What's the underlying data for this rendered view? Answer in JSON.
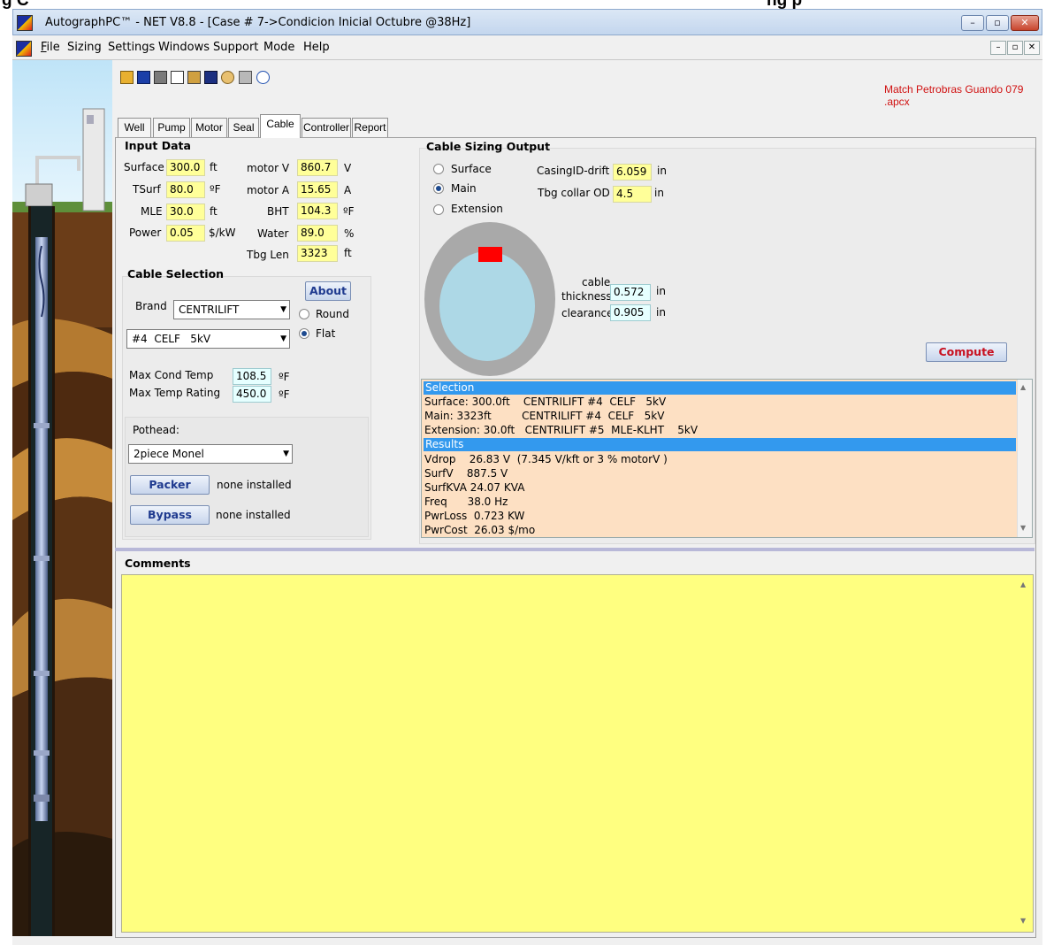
{
  "caption": "g C",
  "caption2": "ng p",
  "window": {
    "title": "AutographPC™ - NET V8.8 - [Case # 7->Condicion Inicial Octubre @38Hz]"
  },
  "menu": [
    "File",
    "Sizing",
    "Settings",
    "Windows",
    "Support",
    "Mode",
    "Help"
  ],
  "match_file": "Match Petrobras Guando 079 .apcx",
  "tabs": [
    "Well",
    "Pump",
    "Motor",
    "Seal",
    "Cable",
    "Controller",
    "Report"
  ],
  "active_tab": "Cable",
  "input_data": {
    "title": "Input Data",
    "surface": {
      "label": "Surface",
      "value": "300.0",
      "unit": "ft"
    },
    "tsurf": {
      "label": "TSurf",
      "value": "80.0",
      "unit": "ºF"
    },
    "mle": {
      "label": "MLE",
      "value": "30.0",
      "unit": "ft"
    },
    "power": {
      "label": "Power",
      "value": "0.05",
      "unit": "$/kW"
    },
    "motor_v": {
      "label": "motor V",
      "value": "860.7",
      "unit": "V"
    },
    "motor_a": {
      "label": "motor A",
      "value": "15.65",
      "unit": "A"
    },
    "bht": {
      "label": "BHT",
      "value": "104.3",
      "unit": "ºF"
    },
    "water": {
      "label": "Water",
      "value": "89.0",
      "unit": "%"
    },
    "tbg_len": {
      "label": "Tbg Len",
      "value": "3323",
      "unit": "ft"
    }
  },
  "cable_selection": {
    "title": "Cable Selection",
    "about": "About",
    "brand_label": "Brand",
    "brand_value": "CENTRILIFT",
    "cable_value": "#4  CELF   5kV",
    "round": "Round",
    "flat": "Flat",
    "max_cond_temp": {
      "label": "Max Cond Temp",
      "value": "108.5",
      "unit": "ºF"
    },
    "max_temp_rating": {
      "label": "Max Temp Rating",
      "value": "450.0",
      "unit": "ºF"
    },
    "pothead_label": "Pothead:",
    "pothead_value": "2piece Monel",
    "packer_btn": "Packer",
    "packer_status": "none installed",
    "bypass_btn": "Bypass",
    "bypass_status": "none installed"
  },
  "output": {
    "title": "Cable Sizing Output",
    "radios": [
      "Surface",
      "Main",
      "Extension"
    ],
    "selected_radio": "Main",
    "casing_label": "CasingID-drift",
    "casing_value": "6.059",
    "casing_unit": "in",
    "tbg_label": "Tbg collar OD",
    "tbg_value": "4.5",
    "tbg_unit": "in",
    "cable_label1": "cable",
    "thickness_label": "thickness",
    "thickness_value": "0.572",
    "thickness_unit": "in",
    "clearance_label": "clearance",
    "clearance_value": "0.905",
    "clearance_unit": "in",
    "compute": "Compute"
  },
  "results_box": {
    "selection_header": "Selection",
    "selection_lines": [
      "Surface: 300.0ft    CENTRILIFT #4  CELF   5kV",
      "Main: 3323ft         CENTRILIFT #4  CELF   5kV",
      "Extension: 30.0ft   CENTRILIFT #5  MLE-KLHT    5kV"
    ],
    "results_header": "Results",
    "results_lines": [
      "Vdrop    26.83 V  (7.345 V/kft or 3 % motorV )",
      "SurfV    887.5 V",
      "SurfKVA 24.07 KVA",
      "Freq      38.0 Hz",
      "PwrLoss  0.723 KW",
      "PwrCost  26.03 $/mo"
    ]
  },
  "comments": {
    "title": "Comments",
    "text": ""
  },
  "colors": {
    "input_yellow": "#ffff99",
    "calc_cyan": "#e6ffff",
    "results_bg": "#fde0c3",
    "header_blue": "#3399ee",
    "comments_yellow": "#ffff80",
    "match_red": "#d01010",
    "cable_red": "#ff0000"
  }
}
